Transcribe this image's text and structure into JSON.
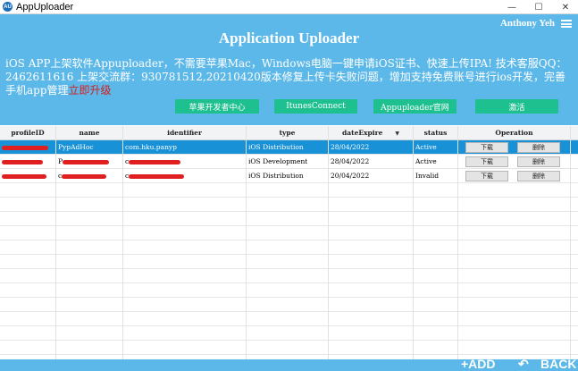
{
  "window": {
    "app_icon_label": "AU",
    "title": "AppUploader",
    "minimize": "—",
    "maximize": "☐",
    "close": "✕"
  },
  "header": {
    "user_name": "Anthony Yeh",
    "title": "Application Uploader",
    "notice": "iOS APP上架软件Appuploader，不需要苹果Mac，Windows电脑一键申请iOS证书、快速上传IPA! 技术客服QQ：2462611616 上架交流群：930781512,20210420版本修复上传卡失败问题，增加支持免费账号进行ios开发，完善手机app管理",
    "upgrade_link": "立即升级",
    "buttons": [
      "苹果开发者中心",
      "ItunesConnect",
      "Appuploader官网",
      "激活"
    ]
  },
  "table": {
    "columns": [
      "profileID",
      "name",
      "identifier",
      "type",
      "dateExpire",
      "status",
      "Operation"
    ],
    "sort_indicator": "▼",
    "rows": [
      {
        "profileID": "",
        "name": "PypAdHoc",
        "identifier": "com.hku.panyp",
        "type": "iOS Distribution",
        "dateExpire": "28/04/2022",
        "status": "Active",
        "download": "下载",
        "delete": "删除",
        "selected": true
      },
      {
        "profileID": "",
        "name": "P",
        "identifier": "c",
        "type": "iOS Development",
        "dateExpire": "28/04/2022",
        "status": "Active",
        "download": "下载",
        "delete": "删除",
        "selected": false
      },
      {
        "profileID": "",
        "name": "c",
        "identifier": "c",
        "type": "iOS Distribution",
        "dateExpire": "20/04/2022",
        "status": "Invalid",
        "download": "下载",
        "delete": "删除",
        "selected": false
      }
    ]
  },
  "footer": {
    "add_label": "+ADD",
    "back_label": "BACK",
    "back_icon": "↶"
  },
  "colors": {
    "header_bg": "#5cb8e8",
    "button_bg": "#1fc090",
    "selected_row": "#1891d6",
    "redaction": "#e02020"
  }
}
